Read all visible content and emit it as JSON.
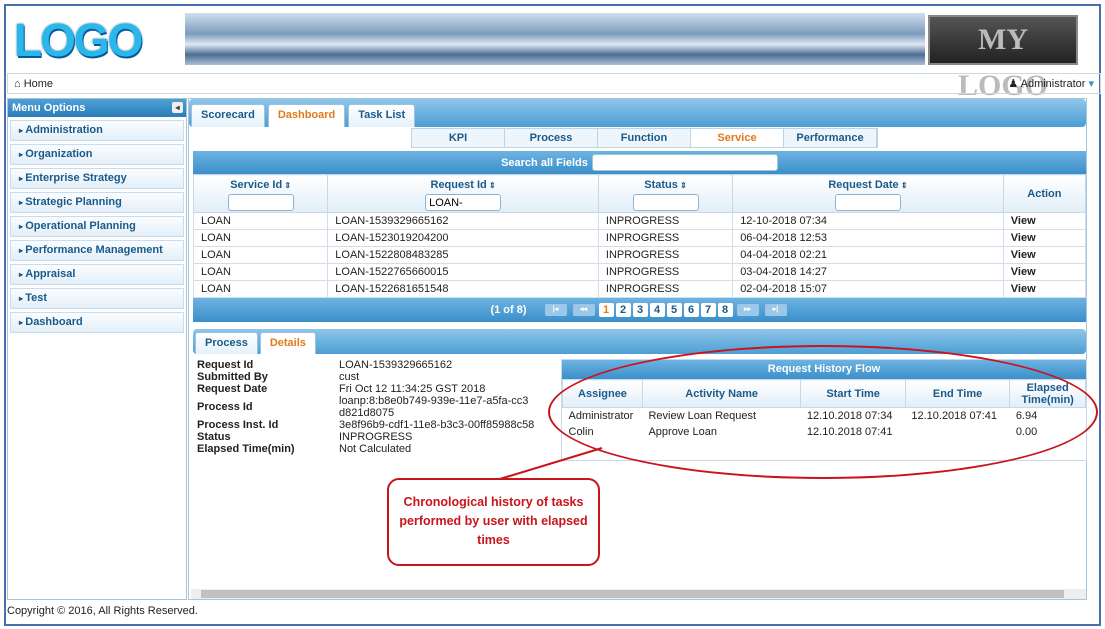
{
  "header": {
    "logo_text": "LOGO",
    "right_logo_text": "MY LOGO"
  },
  "nav": {
    "home": "Home",
    "user": "Administrator"
  },
  "sidebar": {
    "title": "Menu Options",
    "items": [
      {
        "label": "Administration"
      },
      {
        "label": "Organization"
      },
      {
        "label": "Enterprise Strategy"
      },
      {
        "label": "Strategic Planning"
      },
      {
        "label": "Operational Planning"
      },
      {
        "label": "Performance Management"
      },
      {
        "label": "Appraisal"
      },
      {
        "label": "Test"
      },
      {
        "label": "Dashboard"
      }
    ]
  },
  "tabs": [
    "Scorecard",
    "Dashboard",
    "Task List"
  ],
  "subtabs": [
    "KPI",
    "Process",
    "Function",
    "Service",
    "Performance"
  ],
  "grid": {
    "search_label": "Search all Fields",
    "search_value": "",
    "columns": [
      "Service Id",
      "Request Id",
      "Status",
      "Request Date",
      "Action"
    ],
    "filters": {
      "service_id": "",
      "request_id": "LOAN-",
      "status": "",
      "request_date": ""
    },
    "rows": [
      [
        "LOAN",
        "LOAN-1539329665162",
        "INPROGRESS",
        "12-10-2018 07:34",
        "View"
      ],
      [
        "LOAN",
        "LOAN-1523019204200",
        "INPROGRESS",
        "06-04-2018 12:53",
        "View"
      ],
      [
        "LOAN",
        "LOAN-1522808483285",
        "INPROGRESS",
        "04-04-2018 02:21",
        "View"
      ],
      [
        "LOAN",
        "LOAN-1522765660015",
        "INPROGRESS",
        "03-04-2018 14:27",
        "View"
      ],
      [
        "LOAN",
        "LOAN-1522681651548",
        "INPROGRESS",
        "02-04-2018 15:07",
        "View"
      ]
    ],
    "pager": {
      "summary": "(1 of 8)",
      "pages": [
        "1",
        "2",
        "3",
        "4",
        "5",
        "6",
        "7",
        "8"
      ],
      "current": "1"
    }
  },
  "lower_tabs": [
    "Process",
    "Details"
  ],
  "details": [
    [
      "Request Id",
      "LOAN-1539329665162"
    ],
    [
      "Submitted By",
      "cust"
    ],
    [
      "Request Date",
      "Fri Oct 12 11:34:25 GST 2018"
    ],
    [
      "Process Id",
      "loanp:8:b8e0b749-939e-11e7-a5fa-cc3d821d8075"
    ],
    [
      "Process Inst. Id",
      "3e8f96b9-cdf1-11e8-b3c3-00ff85988c58"
    ],
    [
      "Status",
      "INPROGRESS"
    ],
    [
      "Elapsed Time(min)",
      "Not Calculated"
    ]
  ],
  "history": {
    "title": "Request History Flow",
    "columns": [
      "Assignee",
      "Activity Name",
      "Start Time",
      "End Time",
      "Elapsed Time(min)"
    ],
    "rows": [
      [
        "Administrator",
        "Review Loan Request",
        "12.10.2018 07:34",
        "12.10.2018 07:41",
        "6.94"
      ],
      [
        "Colin",
        "Approve Loan",
        "12.10.2018 07:41",
        "",
        "0.00"
      ]
    ]
  },
  "callout": "Chronological history of tasks performed by user with elapsed times",
  "footer": "Copyright © 2016, All Rights Reserved.",
  "colors": {
    "accent": "#3b8fca",
    "active_tab": "#e27a1a",
    "annotation": "#c8141c"
  }
}
